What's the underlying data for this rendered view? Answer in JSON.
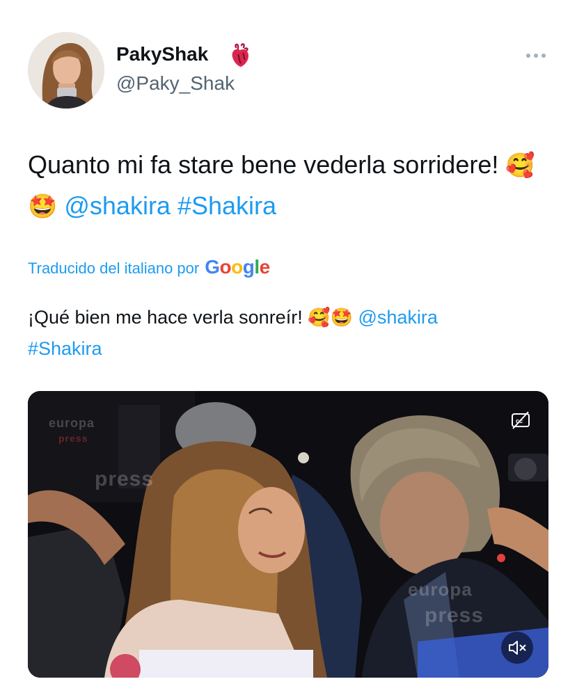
{
  "author": {
    "name": "PakyShak",
    "handle": "@Paky_Shak",
    "badge_icon": "anatomical-heart-icon"
  },
  "tweet": {
    "text_before": "Quanto mi fa stare bene vederla sorridere! ",
    "emoji_1": "🥰",
    "emoji_2": "🤩",
    "mention": "@shakira",
    "hashtag": "#Shakira"
  },
  "translation": {
    "label": "Traducido del italiano por",
    "provider": "Google",
    "text_before": "¡Qué bien me hace verla sonreír! ",
    "emoji_1": "🥰",
    "emoji_2": "🤩",
    "mention": "@shakira",
    "hashtag": "#Shakira"
  },
  "video": {
    "watermark_1": "europa",
    "watermark_2": "press",
    "watermark_3": "press",
    "watermark_4": "europa",
    "watermark_5": "press",
    "cc_icon": "closed-captions-off-icon",
    "mute_icon": "muted-speaker-icon"
  },
  "colors": {
    "link": "#1d9bf0",
    "text": "#0f1419",
    "secondary": "#536471"
  }
}
